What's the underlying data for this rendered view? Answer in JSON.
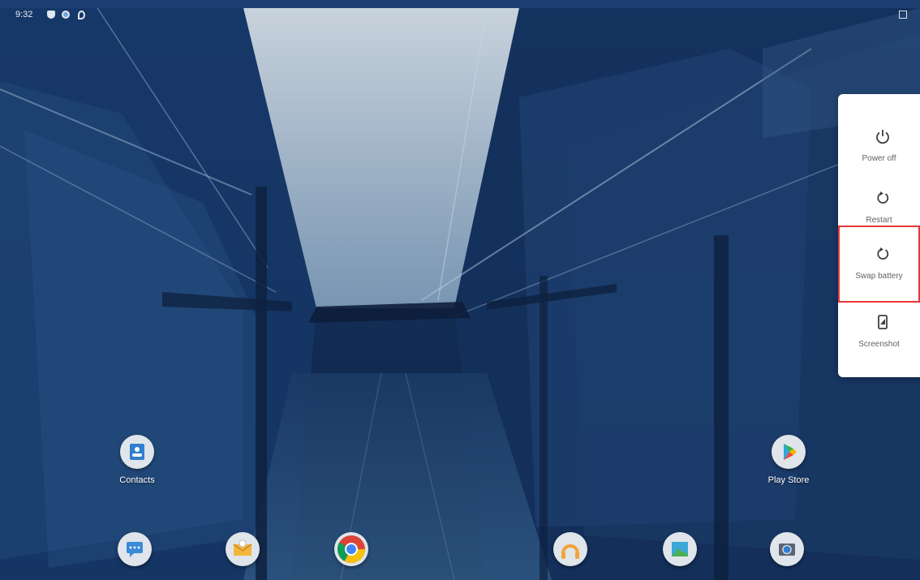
{
  "status_bar": {
    "time": "9:32",
    "icons": [
      "shield-icon",
      "globe-icon",
      "location-icon",
      "sim-icon"
    ]
  },
  "power_menu": {
    "items": [
      {
        "label": "Power off",
        "icon": "power-icon"
      },
      {
        "label": "Restart",
        "icon": "restart-icon"
      },
      {
        "label": "Swap battery",
        "icon": "swap-battery-icon"
      },
      {
        "label": "Screenshot",
        "icon": "screenshot-icon"
      }
    ],
    "highlighted_index": 2,
    "highlight_color": "#e53935"
  },
  "home": {
    "apps": [
      {
        "label": "Contacts",
        "icon": "contacts-icon"
      },
      {
        "label": "Play Store",
        "icon": "play-store-icon"
      }
    ],
    "dock": [
      {
        "icon": "messages-icon"
      },
      {
        "icon": "email-icon"
      },
      {
        "icon": "chrome-icon"
      },
      {
        "icon": "music-icon"
      },
      {
        "icon": "gallery-icon"
      },
      {
        "icon": "camera-icon"
      }
    ]
  }
}
